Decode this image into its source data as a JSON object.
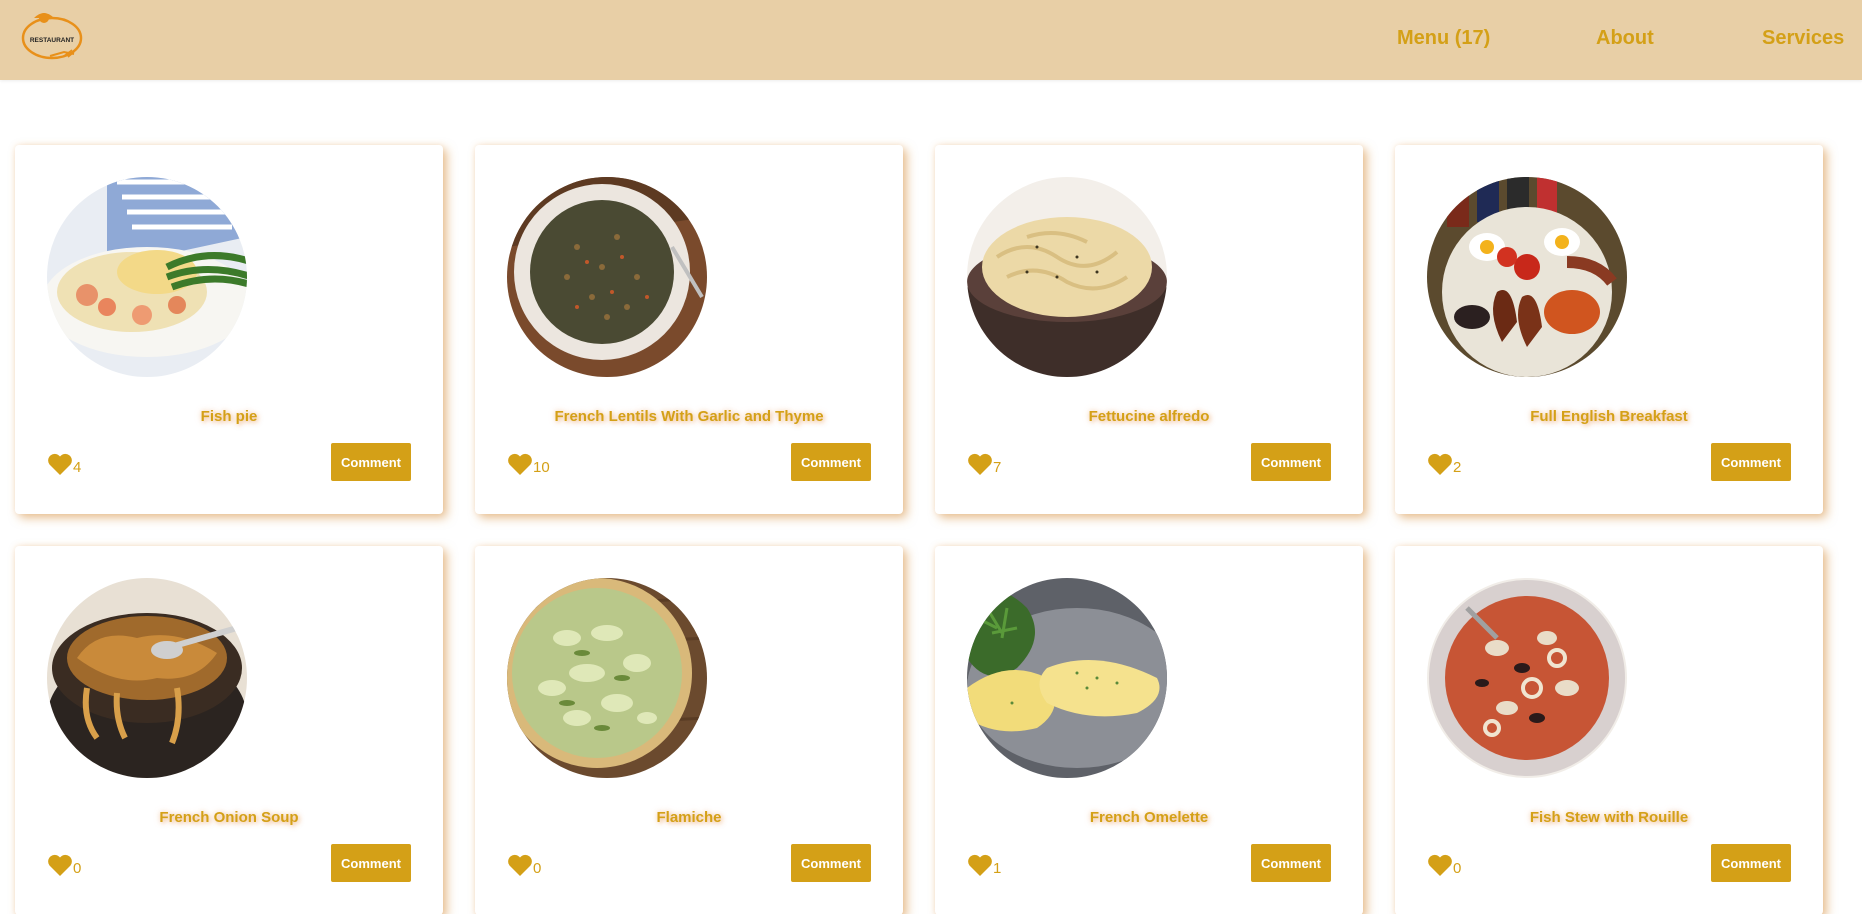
{
  "header": {
    "logo_text": "RESTAURANT",
    "nav": {
      "menu": "Menu (17)",
      "about": "About",
      "services": "Services"
    }
  },
  "colors": {
    "header_bg": "#e8cfa6",
    "accent": "#d4a017"
  },
  "comment_label": "Comment",
  "dishes": [
    {
      "title": "Fish pie",
      "likes": "4",
      "image": "fish-pie"
    },
    {
      "title": "French Lentils With Garlic and Thyme",
      "likes": "10",
      "image": "lentils"
    },
    {
      "title": "Fettucine alfredo",
      "likes": "7",
      "image": "fettucine"
    },
    {
      "title": "Full English Breakfast",
      "likes": "2",
      "image": "english-breakfast"
    },
    {
      "title": "French Onion Soup",
      "likes": "0",
      "image": "onion-soup"
    },
    {
      "title": "Flamiche",
      "likes": "0",
      "image": "flamiche"
    },
    {
      "title": "French Omelette",
      "likes": "1",
      "image": "omelette"
    },
    {
      "title": "Fish Stew with Rouille",
      "likes": "0",
      "image": "fish-stew"
    }
  ]
}
